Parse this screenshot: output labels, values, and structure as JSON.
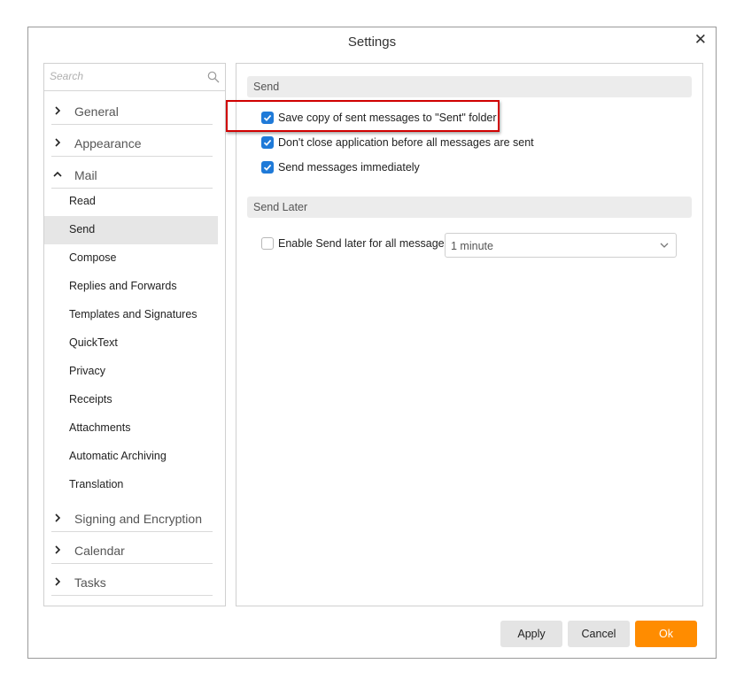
{
  "dialog": {
    "title": "Settings",
    "close_symbol": "✕"
  },
  "search": {
    "placeholder": "Search"
  },
  "sidebar": {
    "groups": [
      {
        "label": "General",
        "expanded": false
      },
      {
        "label": "Appearance",
        "expanded": false
      },
      {
        "label": "Mail",
        "expanded": true
      },
      {
        "label": "Signing and Encryption",
        "expanded": false
      },
      {
        "label": "Calendar",
        "expanded": false
      },
      {
        "label": "Tasks",
        "expanded": false
      }
    ],
    "mail_items": [
      "Read",
      "Send",
      "Compose",
      "Replies and Forwards",
      "Templates and Signatures",
      "QuickText",
      "Privacy",
      "Receipts",
      "Attachments",
      "Automatic Archiving",
      "Translation"
    ],
    "active_item": "Send"
  },
  "content": {
    "send_section": {
      "header": "Send",
      "options": [
        {
          "label": "Save copy of sent messages to \"Sent\" folder",
          "checked": true
        },
        {
          "label": "Don't close application before all messages are sent",
          "checked": true
        },
        {
          "label": "Send messages immediately",
          "checked": true
        }
      ]
    },
    "send_later_section": {
      "header": "Send Later",
      "option": {
        "label": "Enable Send later for all messages",
        "checked": false
      },
      "delay_select": {
        "value": "1 minute"
      }
    }
  },
  "buttons": {
    "apply": "Apply",
    "cancel": "Cancel",
    "ok": "Ok"
  },
  "colors": {
    "checkbox_checked": "#1f7ad8",
    "ok_button": "#ff8c00",
    "highlight_border": "#d00000",
    "active_item_bg": "#e6e6e6"
  }
}
